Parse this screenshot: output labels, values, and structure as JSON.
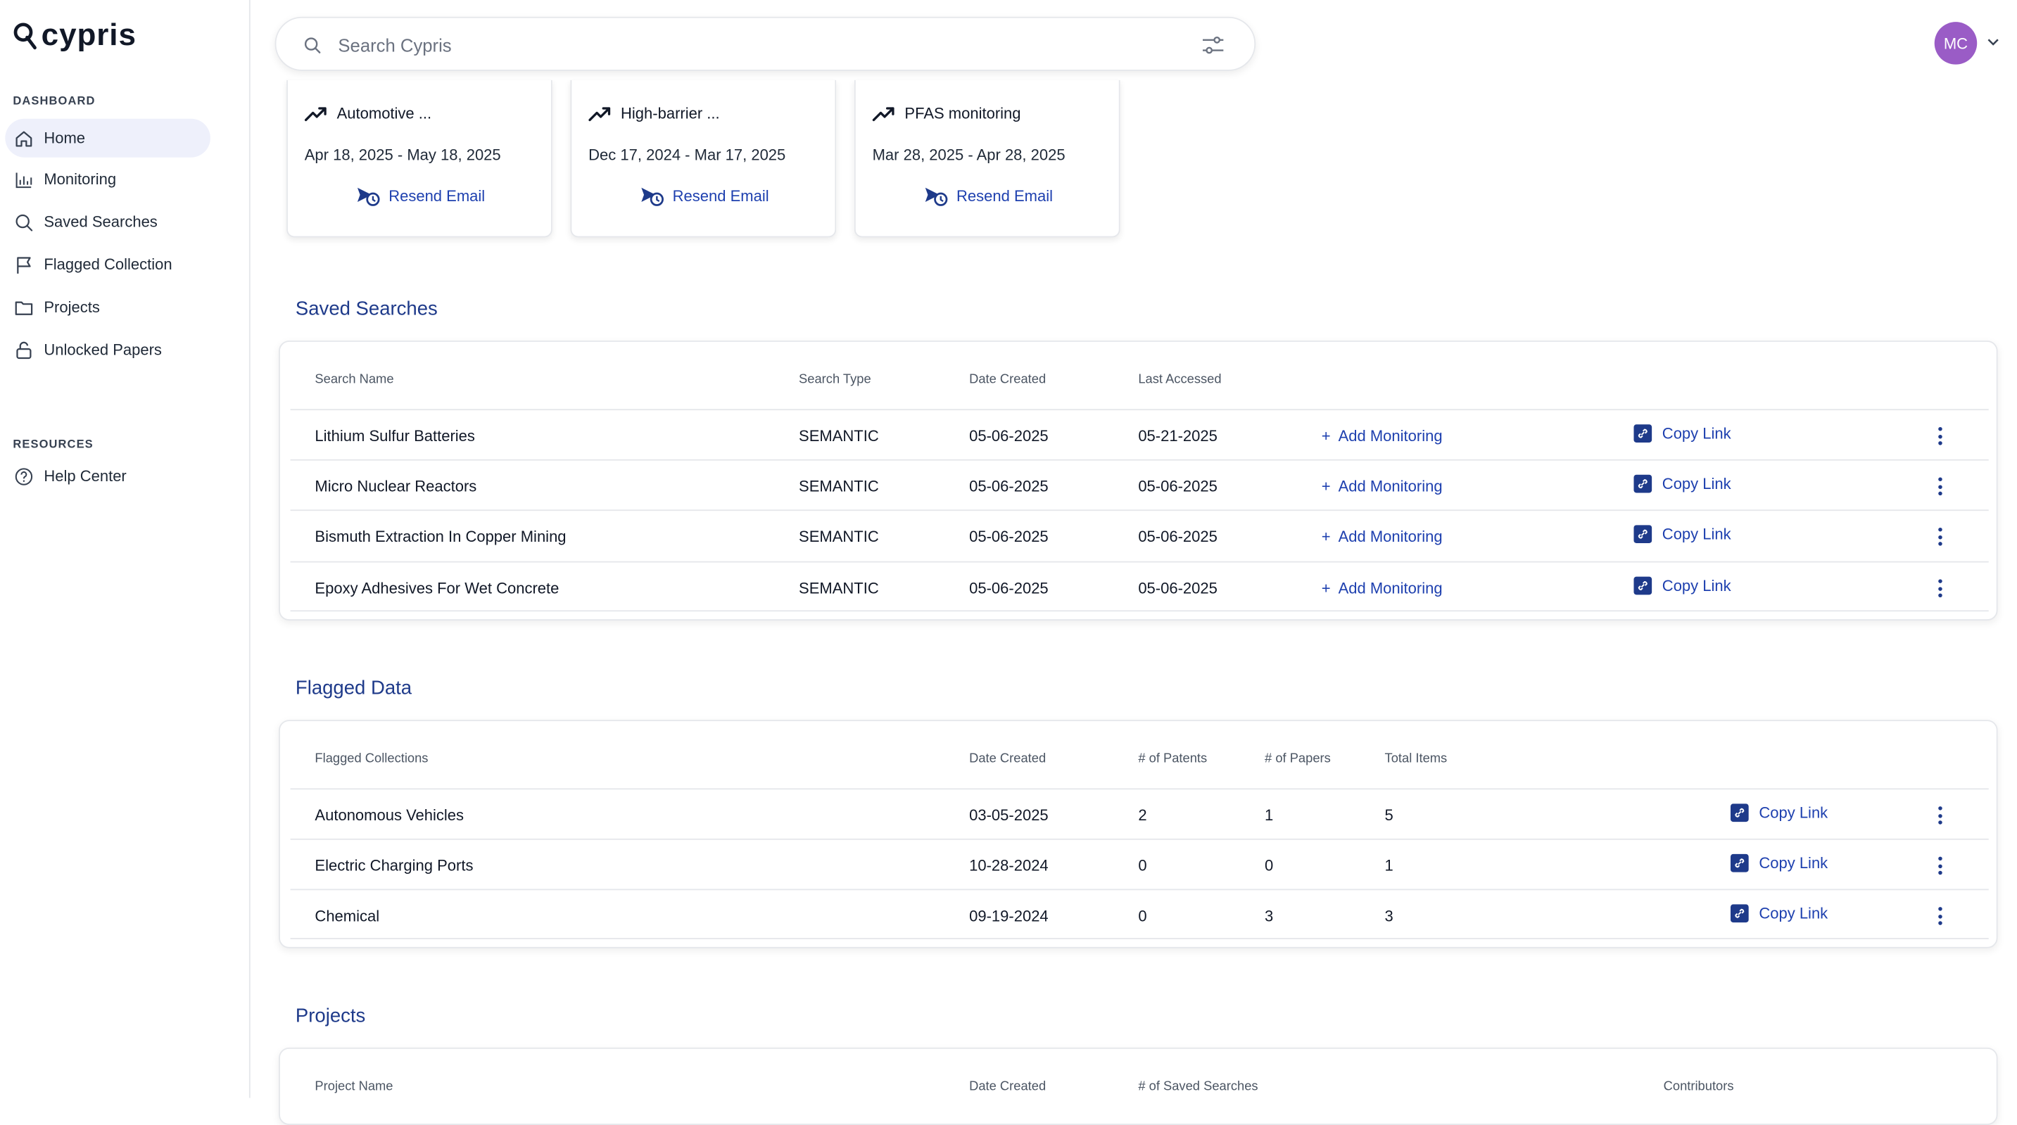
{
  "brand": {
    "name": "cypris"
  },
  "sidebar": {
    "dashboard_label": "DASHBOARD",
    "items": [
      {
        "label": "Home",
        "icon": "home-icon"
      },
      {
        "label": "Monitoring",
        "icon": "chart-icon"
      },
      {
        "label": "Saved Searches",
        "icon": "search-icon"
      },
      {
        "label": "Flagged Collection",
        "icon": "flag-icon"
      },
      {
        "label": "Projects",
        "icon": "folder-icon"
      },
      {
        "label": "Unlocked Papers",
        "icon": "unlock-icon"
      }
    ],
    "resources_label": "RESOURCES",
    "resources": [
      {
        "label": "Help Center",
        "icon": "help-icon"
      }
    ]
  },
  "search": {
    "placeholder": "Search Cypris"
  },
  "user": {
    "initials": "MC",
    "color": "#9a5cc6"
  },
  "monitoring_cards": [
    {
      "title": "Automotive ...",
      "dates": "Apr 18, 2025 - May 18, 2025",
      "action": "Resend Email"
    },
    {
      "title": "High-barrier ...",
      "dates": "Dec 17, 2024 - Mar 17, 2025",
      "action": "Resend Email"
    },
    {
      "title": "PFAS monitoring",
      "dates": "Mar 28, 2025 - Apr 28, 2025",
      "action": "Resend Email"
    }
  ],
  "saved_searches": {
    "title": "Saved Searches",
    "headers": [
      "Search Name",
      "Search Type",
      "Date Created",
      "Last Accessed"
    ],
    "add_label": "Add Monitoring",
    "copy_label": "Copy Link",
    "rows": [
      {
        "name": "Lithium Sulfur Batteries",
        "type": "SEMANTIC",
        "created": "05-06-2025",
        "accessed": "05-21-2025"
      },
      {
        "name": "Micro Nuclear Reactors",
        "type": "SEMANTIC",
        "created": "05-06-2025",
        "accessed": "05-06-2025"
      },
      {
        "name": "Bismuth Extraction In Copper Mining",
        "type": "SEMANTIC",
        "created": "05-06-2025",
        "accessed": "05-06-2025"
      },
      {
        "name": "Epoxy Adhesives For Wet Concrete",
        "type": "SEMANTIC",
        "created": "05-06-2025",
        "accessed": "05-06-2025"
      }
    ]
  },
  "flagged": {
    "title": "Flagged Data",
    "headers": [
      "Flagged Collections",
      "Date Created",
      "# of Patents",
      "# of Papers",
      "Total Items"
    ],
    "copy_label": "Copy Link",
    "rows": [
      {
        "name": "Autonomous Vehicles",
        "created": "03-05-2025",
        "patents": "2",
        "papers": "1",
        "total": "5"
      },
      {
        "name": "Electric Charging Ports",
        "created": "10-28-2024",
        "patents": "0",
        "papers": "0",
        "total": "1"
      },
      {
        "name": "Chemical",
        "created": "09-19-2024",
        "patents": "0",
        "papers": "3",
        "total": "3"
      }
    ]
  },
  "projects": {
    "title": "Projects",
    "headers": [
      "Project Name",
      "Date Created",
      "# of Saved Searches",
      "Contributors"
    ]
  },
  "colors": {
    "accent": "#1e40af",
    "title": "#1e3a8a",
    "active_bg": "#eef0fb"
  }
}
